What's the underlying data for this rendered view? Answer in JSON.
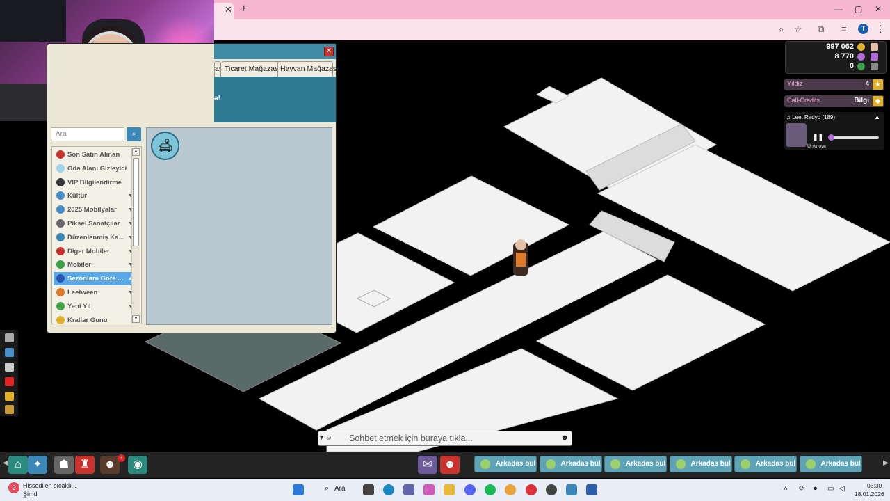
{
  "browser": {
    "tab_close": "✕",
    "new_tab": "+",
    "window_controls": [
      "—",
      "▢",
      "✕"
    ],
    "profile_letter": "T"
  },
  "hud": {
    "credits": "997 062",
    "duckets": "8 770",
    "diamonds": "0",
    "stars_label": "Yıldız",
    "stars_value": "4",
    "callcredits_label": "Call-Credits",
    "callcredits_value": "Bilgi"
  },
  "radio": {
    "title": "♫ Leet Radyo (189)",
    "track": "Unknown",
    "volume_percent": 0
  },
  "catalog": {
    "close": "✕",
    "tabs": [
      "ası",
      "Ticaret Mağazası",
      "Hayvan Mağazası"
    ],
    "banner_text": "a!",
    "search_placeholder": "Ara",
    "categories": [
      {
        "label": "Son Satın Alınan",
        "icon_color": "#c8332d",
        "arrow": ""
      },
      {
        "label": "Oda Alanı Gizleyici",
        "icon_color": "#9fd3ea",
        "arrow": ""
      },
      {
        "label": "VIP Bilgilendirme",
        "icon_color": "#333333",
        "arrow": ""
      },
      {
        "label": "Kültür",
        "icon_color": "#4a90c8",
        "arrow": "▼"
      },
      {
        "label": "2025 Mobilyalar",
        "icon_color": "#4a90c8",
        "arrow": "▼"
      },
      {
        "label": "Piksel Sanatçılar",
        "icon_color": "#6a6a6a",
        "arrow": "▼"
      },
      {
        "label": "Düzenlenmiş Ka...",
        "icon_color": "#3b87b6",
        "arrow": "▼"
      },
      {
        "label": "Diger Mobiler",
        "icon_color": "#c8332d",
        "arrow": "▼"
      },
      {
        "label": "Mobiler",
        "icon_color": "#3fa04a",
        "arrow": "▼"
      },
      {
        "label": "Sezonlara Gore ...",
        "icon_color": "#2a55b0",
        "arrow": "▲",
        "selected": true
      },
      {
        "label": "Leetween",
        "icon_color": "#e07b2a",
        "arrow": "▼"
      },
      {
        "label": "Yeni Yıl",
        "icon_color": "#3fa04a",
        "arrow": "▼"
      },
      {
        "label": "Krallar Gunu",
        "icon_color": "#e0b02a",
        "arrow": ""
      }
    ]
  },
  "chat": {
    "placeholder": "Sohbet etmek için buraya tıkla..."
  },
  "gamebar": {
    "friend_button": "Arkadas bul",
    "friend_count": 6,
    "badge_count": "3"
  },
  "taskbar": {
    "weather_line1": "Hissedilen sıcaklı...",
    "weather_line2": "Şimdi",
    "weather_badge": "2",
    "search_label": "Ara",
    "time": "03:30",
    "date": "18.01.2026"
  },
  "colors": {
    "browser_tab": "#f7b8cf",
    "catalog_accent": "#3e8ca8",
    "selected_category": "#5aa9e6",
    "friend_button": "#5fa3b6"
  }
}
